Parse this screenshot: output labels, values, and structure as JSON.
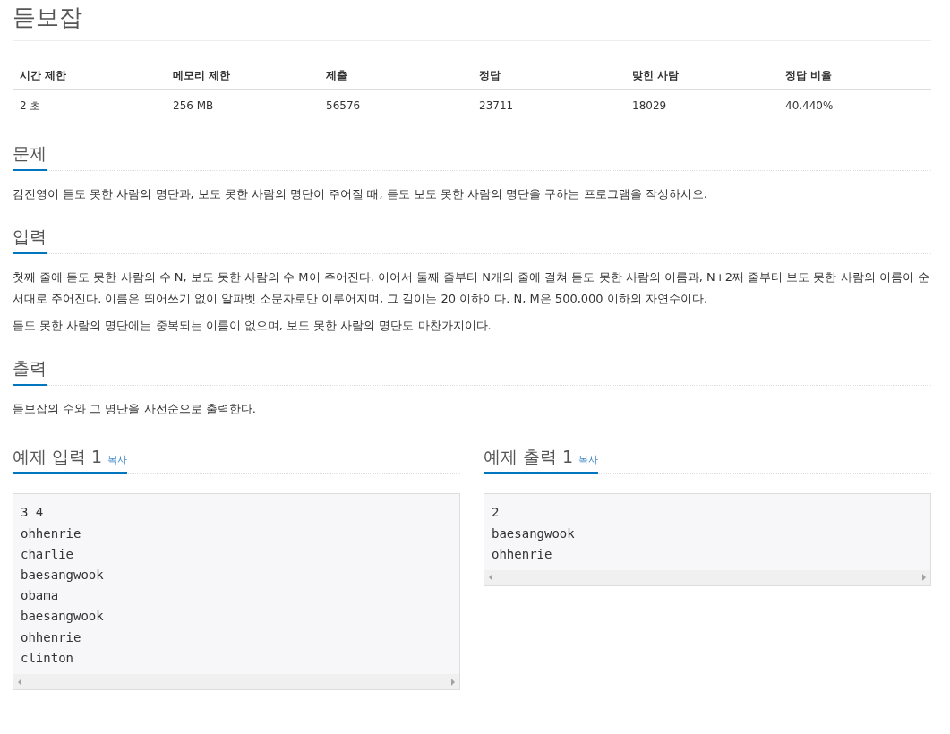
{
  "title": "듣보잡",
  "stats": {
    "columns": [
      "시간 제한",
      "메모리 제한",
      "제출",
      "정답",
      "맞힌 사람",
      "정답 비율"
    ],
    "row": [
      "2 초",
      "256 MB",
      "56576",
      "23711",
      "18029",
      "40.440%"
    ]
  },
  "sections": [
    {
      "heading": "문제",
      "paragraphs": [
        "김진영이 듣도 못한 사람의 명단과, 보도 못한 사람의 명단이 주어질 때, 듣도 보도 못한 사람의 명단을 구하는 프로그램을 작성하시오."
      ]
    },
    {
      "heading": "입력",
      "paragraphs": [
        "첫째 줄에 듣도 못한 사람의 수 N, 보도 못한 사람의 수 M이 주어진다. 이어서 둘째 줄부터 N개의 줄에 걸쳐 듣도 못한 사람의 이름과, N+2째 줄부터 보도 못한 사람의 이름이 순서대로 주어진다. 이름은 띄어쓰기 없이 알파벳 소문자로만 이루어지며, 그 길이는 20 이하이다. N, M은 500,000 이하의 자연수이다.",
        "듣도 못한 사람의 명단에는 중복되는 이름이 없으며, 보도 못한 사람의 명단도 마찬가지이다."
      ]
    },
    {
      "heading": "출력",
      "paragraphs": [
        "듣보잡의 수와 그 명단을 사전순으로 출력한다."
      ]
    }
  ],
  "samples": [
    {
      "heading": "예제 입력 1",
      "copy": "복사",
      "lines": [
        "3 4",
        "ohhenrie",
        "charlie",
        "baesangwook",
        "obama",
        "baesangwook",
        "ohhenrie",
        "clinton"
      ]
    },
    {
      "heading": "예제 출력 1",
      "copy": "복사",
      "lines": [
        "2",
        "baesangwook",
        "ohhenrie"
      ]
    }
  ]
}
